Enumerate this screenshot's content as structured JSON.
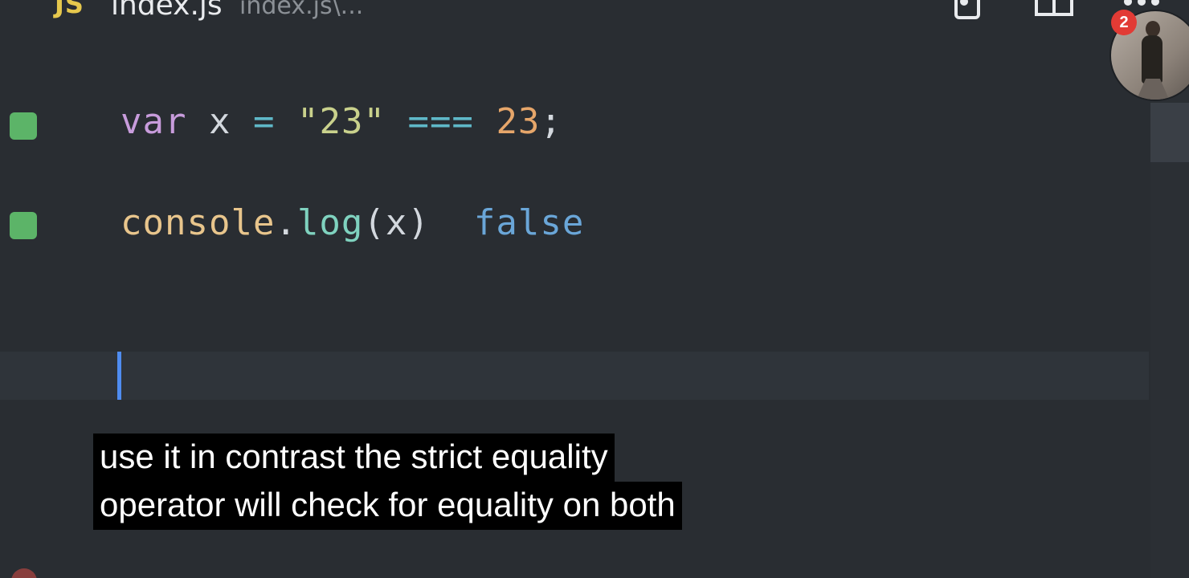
{
  "tab": {
    "lang_badge": "JS",
    "title": "index.js",
    "path": "index.js\\..."
  },
  "toolbar": {
    "preview_icon": "open-preview-icon",
    "split_icon": "split-editor-icon",
    "more_icon": "more-actions-icon"
  },
  "code": {
    "line1": {
      "kw": "var",
      "name": "x",
      "assign": "=",
      "str": "\"23\"",
      "op": "===",
      "num": "23",
      "end": ";"
    },
    "line2": {
      "obj": "console",
      "dot": ".",
      "fn": "log",
      "open": "(",
      "arg": "x",
      "close": ")",
      "result": "false"
    }
  },
  "webcam": {
    "notification_count": "2"
  },
  "captions": {
    "line1": "use it in contrast the strict equality",
    "line2": "operator will check for equality on both"
  },
  "colors": {
    "background": "#292d32",
    "gutter_marker": "#5cb468",
    "cursor": "#4f8cf0",
    "badge": "#e23b35"
  }
}
